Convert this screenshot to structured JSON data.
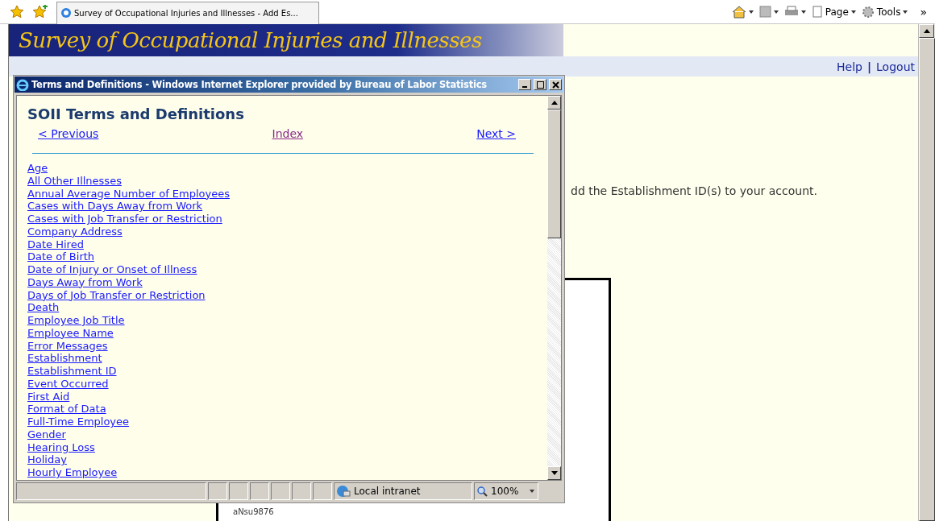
{
  "browser": {
    "tab_title": "Survey of Occupational Injuries and Illnesses - Add Es...",
    "toolbar": [
      "Page",
      "Tools"
    ],
    "more": "»"
  },
  "site": {
    "title": "Survey of Occupational Injuries and Illnesses",
    "links": [
      "Help",
      "Logout"
    ],
    "link_separator": "|",
    "message": "dd the Establishment ID(s) to your account.",
    "card_text": "aNsu9876"
  },
  "popup": {
    "title": "Terms and Definitions - Windows Internet Explorer provided by Bureau of Labor Statistics",
    "heading": "SOII Terms and Definitions",
    "nav": [
      {
        "label": "< Previous",
        "visited": false
      },
      {
        "label": "Index",
        "visited": true
      },
      {
        "label": "Next >",
        "visited": false
      }
    ],
    "terms": [
      "Age",
      "All Other Illnesses",
      "Annual Average Number of Employees",
      "Cases with Days Away from Work",
      "Cases with Job Transfer or Restriction",
      "Company Address",
      "Date Hired",
      "Date of Birth",
      "Date of Injury or Onset of Illness",
      "Days Away from Work",
      "Days of Job Transfer or Restriction",
      "Death",
      "Employee Job Title",
      "Employee Name",
      "Error Messages",
      "Establishment",
      "Establishment ID",
      "Event Occurred",
      "First Aid",
      "Format of Data",
      "Full-Time Employee",
      "Gender",
      "Hearing Loss",
      "Holiday",
      "Hourly Employee"
    ],
    "status": {
      "zone": "Local intranet",
      "zoom": "100%"
    }
  }
}
